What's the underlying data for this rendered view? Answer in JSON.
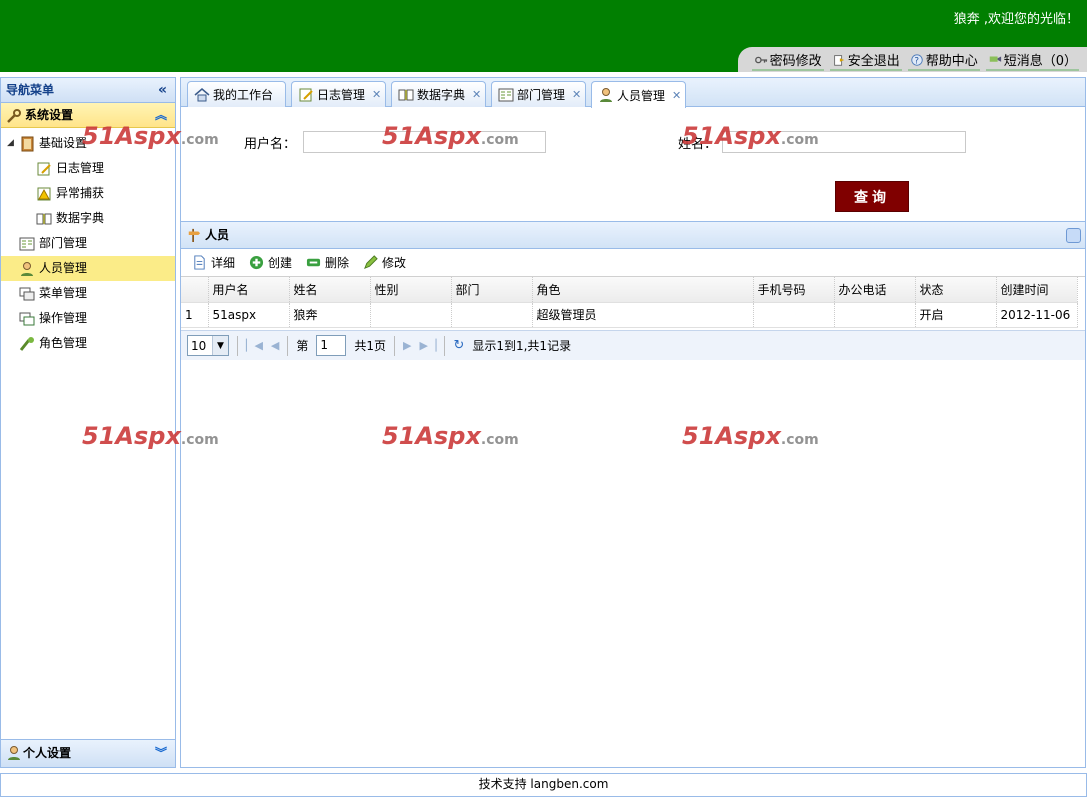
{
  "header": {
    "welcome": "狼奔 ,欢迎您的光临！",
    "links": [
      {
        "label": "密码修改",
        "icon": "key-icon"
      },
      {
        "label": "安全退出",
        "icon": "logout-icon"
      },
      {
        "label": "帮助中心",
        "icon": "help-icon"
      },
      {
        "label": "短消息（0）",
        "icon": "message-icon"
      }
    ]
  },
  "sidebar": {
    "title": "导航菜单",
    "section": "系统设置",
    "tree": [
      {
        "label": "基础设置",
        "icon": "book-icon"
      },
      {
        "label": "日志管理",
        "icon": "log-icon"
      },
      {
        "label": "异常捕获",
        "icon": "warning-icon"
      },
      {
        "label": "数据字典",
        "icon": "dictionary-icon"
      },
      {
        "label": "部门管理",
        "icon": "department-icon"
      },
      {
        "label": "人员管理",
        "icon": "user-icon"
      },
      {
        "label": "菜单管理",
        "icon": "menu-icon"
      },
      {
        "label": "操作管理",
        "icon": "operation-icon"
      },
      {
        "label": "角色管理",
        "icon": "role-icon"
      }
    ],
    "bottom_section": "个人设置"
  },
  "tabs": [
    {
      "label": "我的工作台",
      "icon": "home-icon",
      "closable": false
    },
    {
      "label": "日志管理",
      "icon": "log-icon",
      "closable": true
    },
    {
      "label": "数据字典",
      "icon": "dictionary-icon",
      "closable": true
    },
    {
      "label": "部门管理",
      "icon": "department-icon",
      "closable": true
    },
    {
      "label": "人员管理",
      "icon": "user-icon",
      "closable": true
    }
  ],
  "search": {
    "username_label": "用户名：",
    "username_value": "",
    "name_label": "姓名：",
    "name_value": "",
    "button": "查询"
  },
  "grid": {
    "title": "人员",
    "toolbar": [
      "详细",
      "创建",
      "删除",
      "修改"
    ],
    "columns": [
      "",
      "用户名",
      "姓名",
      "性别",
      "部门",
      "角色",
      "手机号码",
      "办公电话",
      "状态",
      "创建时间"
    ],
    "rows": [
      [
        "1",
        "51aspx",
        "狼奔",
        "",
        "",
        "超级管理员",
        "",
        "",
        "开启",
        "2012-11-06"
      ]
    ]
  },
  "pager": {
    "page_size": "10",
    "page_prefix": "第",
    "current_page": "1",
    "page_suffix": "共1页",
    "info": "显示1到1,共1记录"
  },
  "footer": "技术支持 langben.com",
  "watermark": {
    "main": "51Aspx",
    "suffix": ".com"
  },
  "colors": {
    "header": "#017f01",
    "accent_bar": "#800000",
    "selected_row": "#fbec88",
    "panel_border": "#99bbe8"
  }
}
